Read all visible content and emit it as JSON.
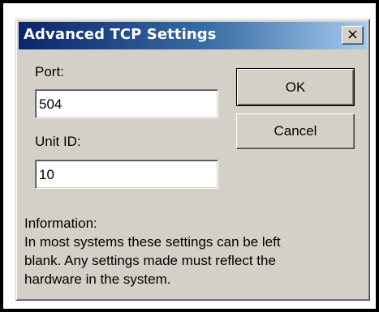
{
  "titlebar": {
    "title": "Advanced TCP Settings",
    "close_label": "×",
    "close_icon": "close-icon"
  },
  "form": {
    "port_label": "Port:",
    "port_value": "504",
    "unit_id_label": "Unit ID:",
    "unit_id_value": "10"
  },
  "buttons": {
    "ok_label": "OK",
    "cancel_label": "Cancel"
  },
  "info": {
    "heading": "Information:",
    "lines": [
      "In most systems these settings can be left",
      "blank. Any settings made must reflect the",
      "hardware in the system."
    ]
  },
  "colors": {
    "dialog_face": "#d4d0c8",
    "title_start": "#0a246a",
    "title_end": "#a6caf0",
    "frame": "#000000"
  }
}
